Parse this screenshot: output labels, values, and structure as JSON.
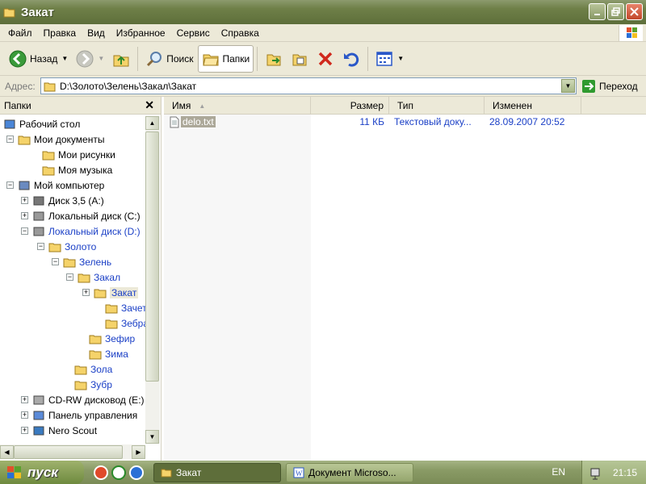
{
  "window": {
    "title": "Закат",
    "minimize_icon": "minimize-icon",
    "maximize_icon": "maximize-icon",
    "close_icon": "close-icon"
  },
  "menu": [
    "Файл",
    "Правка",
    "Вид",
    "Избранное",
    "Сервис",
    "Справка"
  ],
  "toolbar": {
    "back_label": "Назад",
    "search_label": "Поиск",
    "folders_label": "Папки"
  },
  "address": {
    "label": "Адрес:",
    "path": "D:\\Золото\\Зелень\\Закал\\Закат",
    "go_label": "Переход"
  },
  "folders_pane": {
    "title": "Папки",
    "close_glyph": "✕",
    "tree": [
      {
        "label": "Рабочий стол",
        "expander": "",
        "icon": "desktop-icon",
        "blue": false,
        "selected": false
      },
      {
        "label": "Мои документы",
        "expander": "−",
        "icon": "my-documents-icon",
        "blue": false,
        "selected": false
      },
      {
        "label": "Мои рисунки",
        "expander": "",
        "icon": "my-pictures-icon",
        "blue": false,
        "selected": false
      },
      {
        "label": "Моя музыка",
        "expander": "",
        "icon": "my-music-icon",
        "blue": false,
        "selected": false
      },
      {
        "label": "Мой компьютер",
        "expander": "−",
        "icon": "my-computer-icon",
        "blue": false,
        "selected": false
      },
      {
        "label": "Диск 3,5 (A:)",
        "expander": "+",
        "icon": "floppy-drive-icon",
        "blue": false,
        "selected": false
      },
      {
        "label": "Локальный диск (C:)",
        "expander": "+",
        "icon": "hard-drive-icon",
        "blue": false,
        "selected": false
      },
      {
        "label": "Локальный диск (D:)",
        "expander": "−",
        "icon": "hard-drive-icon",
        "blue": true,
        "selected": false
      },
      {
        "label": "Золото",
        "expander": "−",
        "icon": "folder-icon",
        "blue": true,
        "selected": false
      },
      {
        "label": "Зелень",
        "expander": "−",
        "icon": "folder-icon",
        "blue": true,
        "selected": false
      },
      {
        "label": "Закал",
        "expander": "−",
        "icon": "folder-icon",
        "blue": true,
        "selected": false
      },
      {
        "label": "Закат",
        "expander": "+",
        "icon": "folder-open-icon",
        "blue": true,
        "selected": true
      },
      {
        "label": "Зачет",
        "expander": "",
        "icon": "folder-icon",
        "blue": true,
        "selected": false
      },
      {
        "label": "Зебра",
        "expander": "",
        "icon": "folder-icon",
        "blue": true,
        "selected": false
      },
      {
        "label": "Зефир",
        "expander": "",
        "icon": "folder-icon",
        "blue": true,
        "selected": false
      },
      {
        "label": "Зима",
        "expander": "",
        "icon": "folder-icon",
        "blue": true,
        "selected": false
      },
      {
        "label": "Зола",
        "expander": "",
        "icon": "folder-icon",
        "blue": true,
        "selected": false
      },
      {
        "label": "Зубр",
        "expander": "",
        "icon": "folder-icon",
        "blue": true,
        "selected": false
      },
      {
        "label": "CD-RW дисковод (E:)",
        "expander": "+",
        "icon": "cd-drive-icon",
        "blue": false,
        "selected": false
      },
      {
        "label": "Панель управления",
        "expander": "+",
        "icon": "control-panel-icon",
        "blue": false,
        "selected": false
      },
      {
        "label": "Nero Scout",
        "expander": "+",
        "icon": "nero-scout-icon",
        "blue": false,
        "selected": false
      }
    ]
  },
  "file_list": {
    "columns": {
      "name": "Имя",
      "size": "Размер",
      "type": "Тип",
      "modified": "Изменен"
    },
    "files": [
      {
        "name": "delo.txt",
        "size": "11 КБ",
        "type": "Текстовый доку...",
        "modified": "28.09.2007 20:52"
      }
    ]
  },
  "taskbar": {
    "start_label": "пуск",
    "tasks": [
      {
        "label": "Закат",
        "icon": "folder-icon"
      },
      {
        "label": "Документ Microso...",
        "icon": "word-document-icon"
      }
    ],
    "language": "EN",
    "clock": "21:15"
  }
}
